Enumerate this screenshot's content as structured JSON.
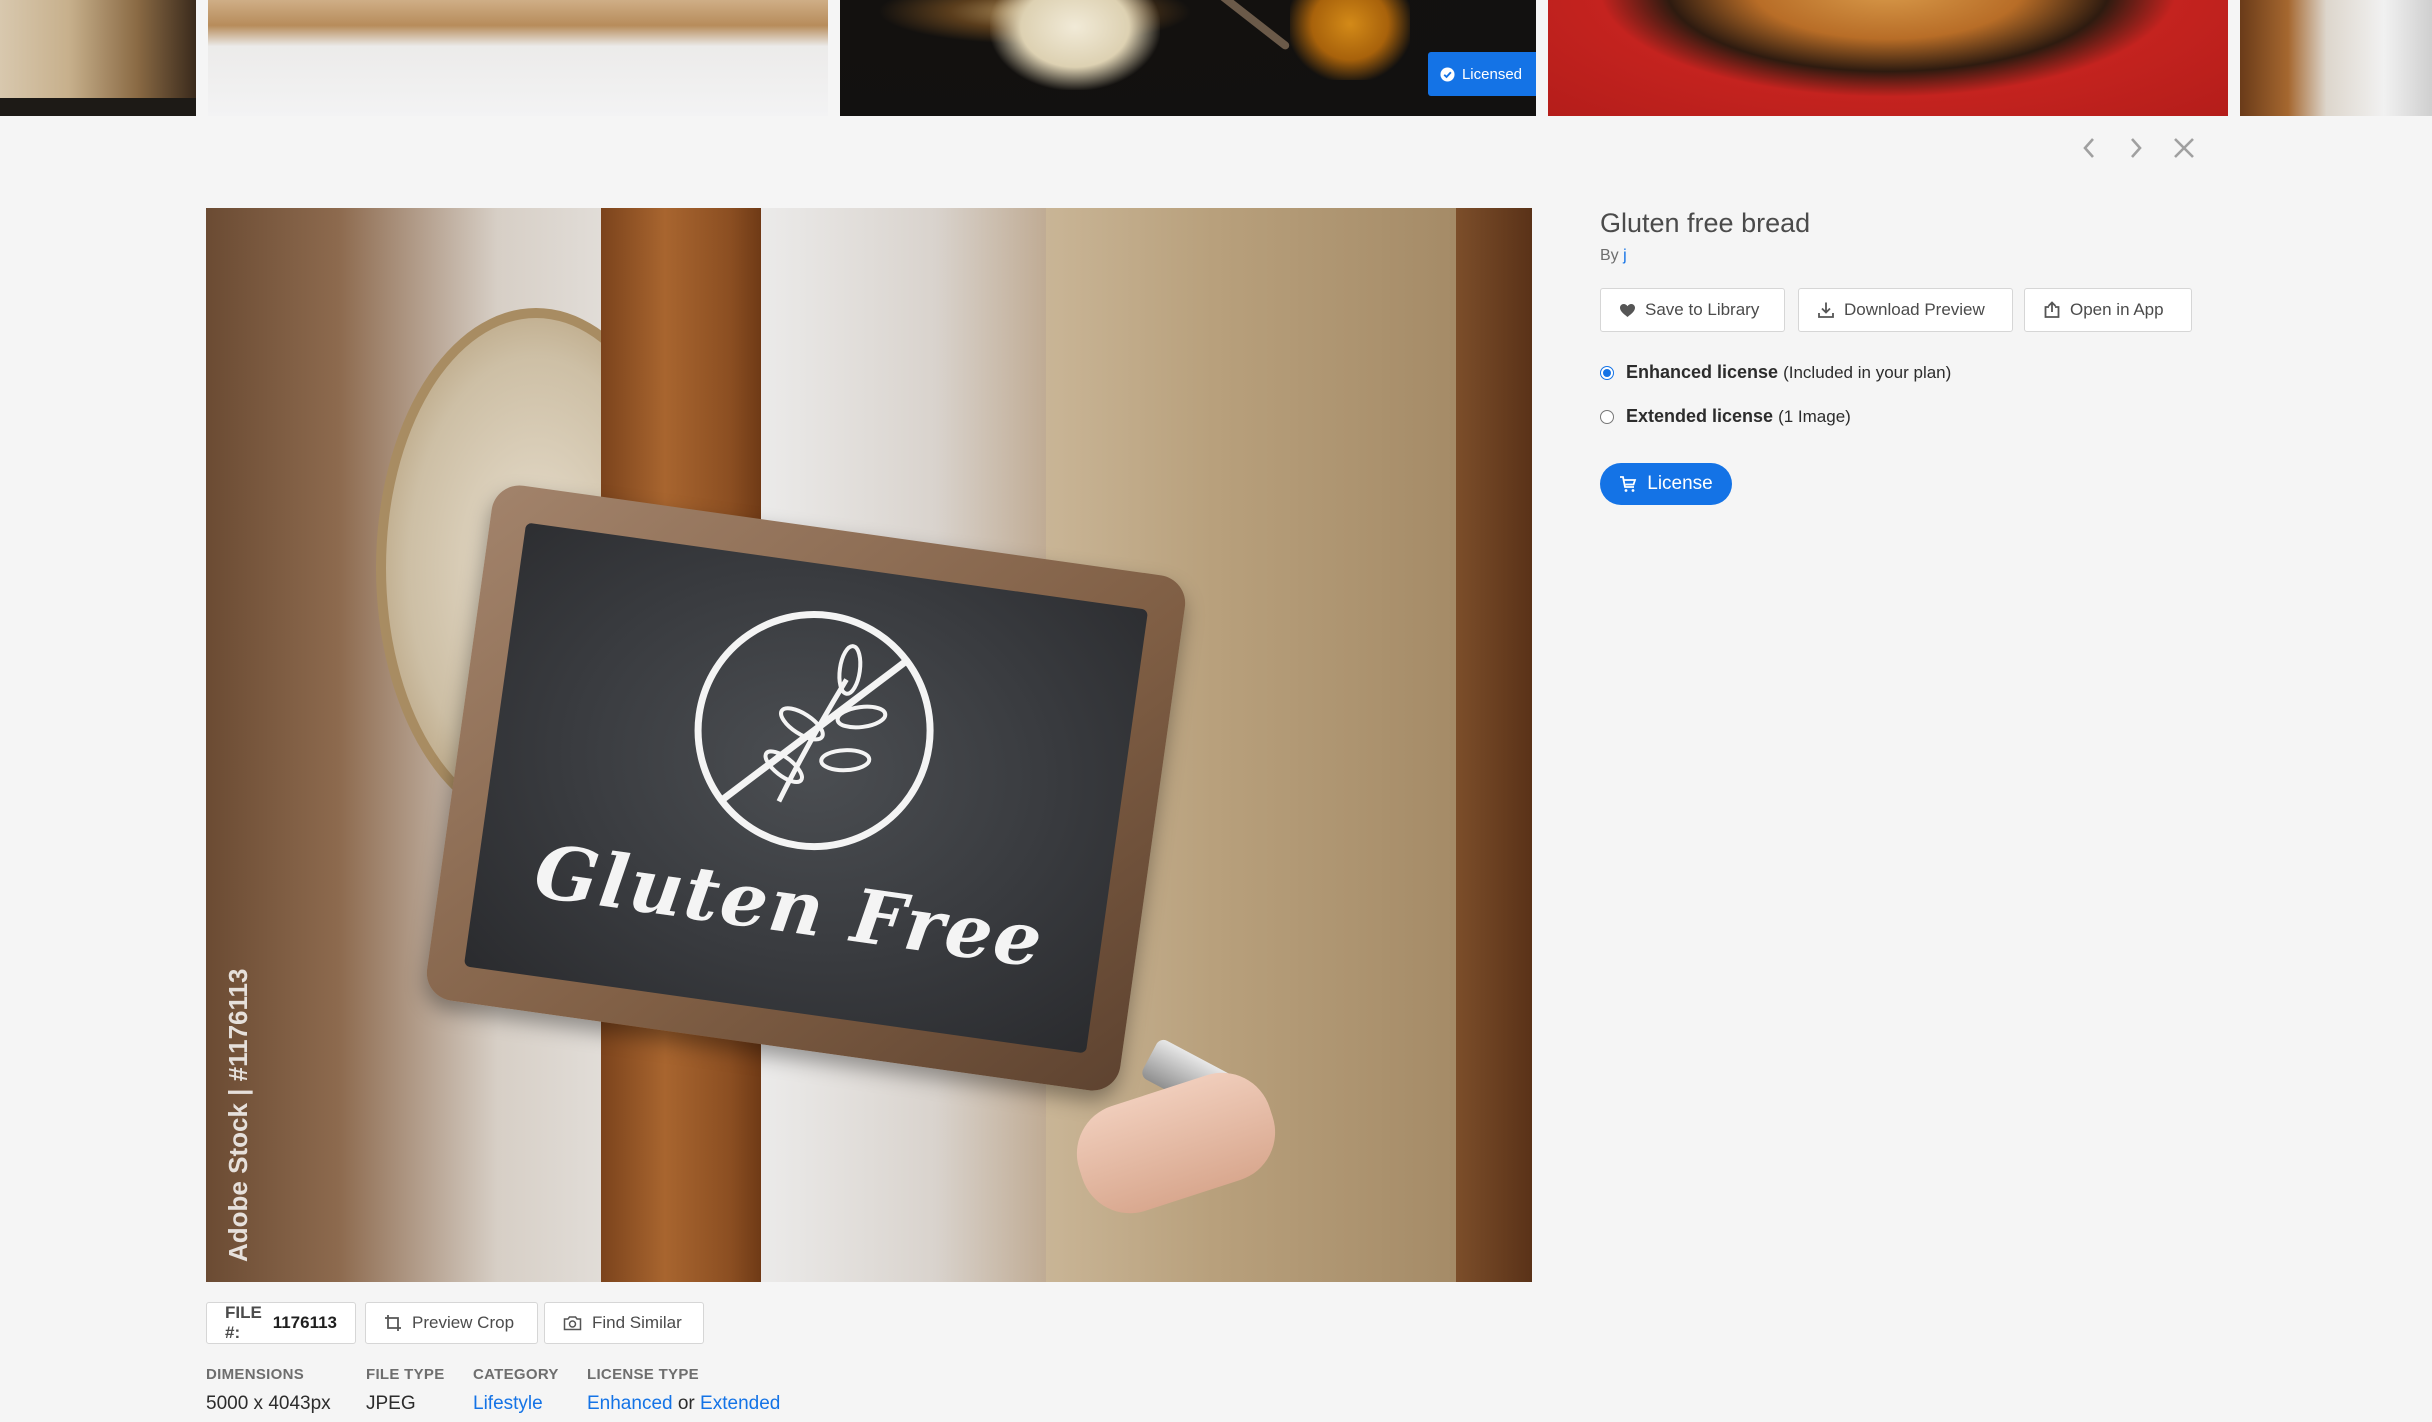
{
  "strip": {
    "licensed_badge": "Licensed"
  },
  "nav": {
    "prev_icon": "chevron-left-icon",
    "next_icon": "chevron-right-icon",
    "close_icon": "close-icon"
  },
  "image": {
    "board_text": "Gluten Free",
    "watermark": "Adobe Stock | #1176113"
  },
  "toolbar": {
    "file_label": "FILE #:",
    "file_number": "1176113",
    "preview_crop": "Preview Crop",
    "find_similar": "Find Similar"
  },
  "meta": {
    "dimensions_label": "DIMENSIONS",
    "dimensions_value": "5000 x 4043px",
    "filetype_label": "FILE TYPE",
    "filetype_value": "JPEG",
    "category_label": "CATEGORY",
    "category_value": "Lifestyle",
    "license_type_label": "LICENSE TYPE",
    "license_enhanced": "Enhanced",
    "license_or": "or",
    "license_extended": "Extended"
  },
  "panel": {
    "title": "Gluten free bread",
    "by": "By",
    "author": "j",
    "save_to_library": "Save to Library",
    "download_preview": "Download Preview",
    "open_in_app": "Open in App",
    "enhanced_license": "Enhanced license",
    "enhanced_note": "(Included in your plan)",
    "extended_license": "Extended license",
    "extended_note": "(1 Image)",
    "selected_license": "Enhanced license",
    "license_button": "License"
  },
  "colors": {
    "accent": "#1473e6",
    "background": "#f5f5f5"
  }
}
